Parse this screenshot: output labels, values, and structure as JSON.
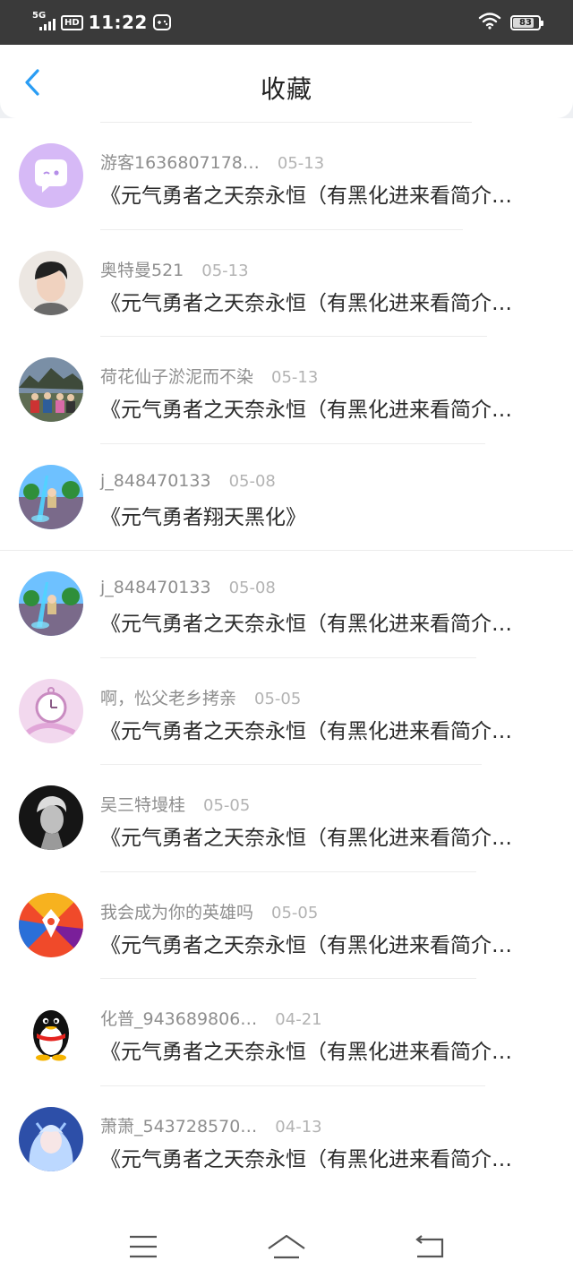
{
  "status_bar": {
    "network": "5G",
    "hd": "HD",
    "time": "11:22",
    "battery": "83",
    "battery_level": 0.83
  },
  "header": {
    "title": "收藏"
  },
  "colors": {
    "accent": "#2a9df4",
    "text_primary": "#2a2a2a",
    "text_secondary": "#8e8e8e",
    "text_date": "#b3b3b3"
  },
  "favorites": [
    {
      "user": "游客1636807178…",
      "date": "05-13",
      "title": "《元气勇者之天奈永恒（有黑化进来看简介…",
      "avatar": "chat-bubble-avatar"
    },
    {
      "user": "奥特曼521",
      "date": "05-13",
      "title": "《元气勇者之天奈永恒（有黑化进来看简介…",
      "avatar": "portrait-avatar"
    },
    {
      "user": "荷花仙子淤泥而不染",
      "date": "05-13",
      "title": "《元气勇者之天奈永恒（有黑化进来看简介…",
      "avatar": "group-photo-avatar"
    },
    {
      "user": "j_848470133",
      "date": "05-08",
      "title": "《元气勇者翔天黑化》",
      "avatar": "game-scene-avatar"
    },
    {
      "user": "j_848470133",
      "date": "05-08",
      "title": "《元气勇者之天奈永恒（有黑化进来看简介…",
      "avatar": "game-scene-avatar"
    },
    {
      "user": "啊，忪父老乡拷亲",
      "date": "05-05",
      "title": "《元气勇者之天奈永恒（有黑化进来看简介…",
      "avatar": "pocket-watch-avatar"
    },
    {
      "user": "吴三特墁桂",
      "date": "05-05",
      "title": "《元气勇者之天奈永恒（有黑化进来看简介…",
      "avatar": "bw-portrait-avatar"
    },
    {
      "user": "我会成为你的英雄吗",
      "date": "05-05",
      "title": "《元气勇者之天奈永恒（有黑化进来看简介…",
      "avatar": "mecha-avatar"
    },
    {
      "user": "化普_943689806…",
      "date": "04-21",
      "title": "《元气勇者之天奈永恒（有黑化进来看简介…",
      "avatar": "penguin-avatar"
    },
    {
      "user": "萧萧_543728570…",
      "date": "04-13",
      "title": "《元气勇者之天奈永恒（有黑化进来看简介…",
      "avatar": "anime-girl-avatar"
    }
  ]
}
